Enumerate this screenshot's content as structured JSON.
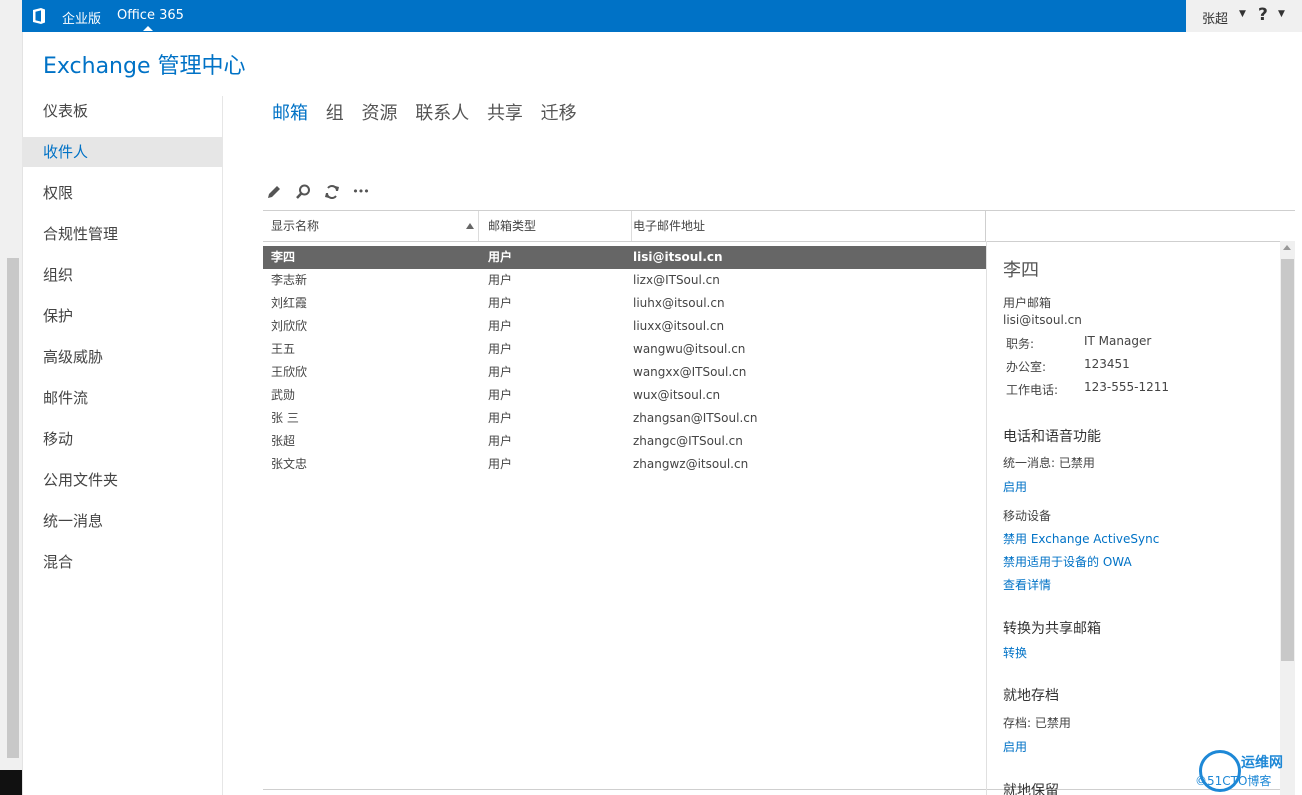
{
  "topbar": {
    "edition": "企业版",
    "product": "Office 365",
    "user": "张超",
    "help": "?"
  },
  "app_title": "Exchange 管理中心",
  "nav": {
    "items": [
      {
        "label": "仪表板"
      },
      {
        "label": "收件人"
      },
      {
        "label": "权限"
      },
      {
        "label": "合规性管理"
      },
      {
        "label": "组织"
      },
      {
        "label": "保护"
      },
      {
        "label": "高级威胁"
      },
      {
        "label": "邮件流"
      },
      {
        "label": "移动"
      },
      {
        "label": "公用文件夹"
      },
      {
        "label": "统一消息"
      },
      {
        "label": "混合"
      }
    ],
    "active": "收件人"
  },
  "tabs": [
    "邮箱",
    "组",
    "资源",
    "联系人",
    "共享",
    "迁移"
  ],
  "active_tab": "邮箱",
  "toolbar": {
    "icons": [
      "edit-icon",
      "search-icon",
      "refresh-icon",
      "more-icon"
    ],
    "more": "•••"
  },
  "table": {
    "headers": [
      "显示名称",
      "邮箱类型",
      "电子邮件地址"
    ],
    "rows": [
      {
        "name": "李四",
        "type": "用户",
        "email": "lisi@itsoul.cn",
        "selected": true
      },
      {
        "name": "李志新",
        "type": "用户",
        "email": "lizx@ITSoul.cn"
      },
      {
        "name": "刘红霞",
        "type": "用户",
        "email": "liuhx@itsoul.cn"
      },
      {
        "name": "刘欣欣",
        "type": "用户",
        "email": "liuxx@itsoul.cn"
      },
      {
        "name": "王五",
        "type": "用户",
        "email": "wangwu@itsoul.cn"
      },
      {
        "name": "王欣欣",
        "type": "用户",
        "email": "wangxx@ITSoul.cn"
      },
      {
        "name": "武勋",
        "type": "用户",
        "email": "wux@itsoul.cn"
      },
      {
        "name": "张 三",
        "type": "用户",
        "email": "zhangsan@ITSoul.cn"
      },
      {
        "name": "张超",
        "type": "用户",
        "email": "zhangc@ITSoul.cn"
      },
      {
        "name": "张文忠",
        "type": "用户",
        "email": "zhangwz@itsoul.cn"
      }
    ]
  },
  "details": {
    "name": "李四",
    "mailbox_type": "用户邮箱",
    "email": "lisi@itsoul.cn",
    "title_label": "职务:",
    "title_value": "IT Manager",
    "office_label": "办公室:",
    "office_value": "123451",
    "phone_label": "工作电话:",
    "phone_value": "123-555-1211",
    "phone_voice_heading": "电话和语音功能",
    "um_label": "统一消息:",
    "um_value": "已禁用",
    "um_enable_link": "启用",
    "mobile_heading": "移动设备",
    "disable_eas_link": "禁用 Exchange ActiveSync",
    "disable_owa_link": "禁用适用于设备的 OWA",
    "view_details_link": "查看详情",
    "convert_heading": "转换为共享邮箱",
    "convert_link": "转换",
    "archive_heading": "就地存档",
    "archive_label": "存档:",
    "archive_value": "已禁用",
    "archive_enable_link": "启用",
    "hold_heading": "就地保留"
  },
  "watermark": {
    "line1": "运维网",
    "line2": "©51CTO博客"
  }
}
